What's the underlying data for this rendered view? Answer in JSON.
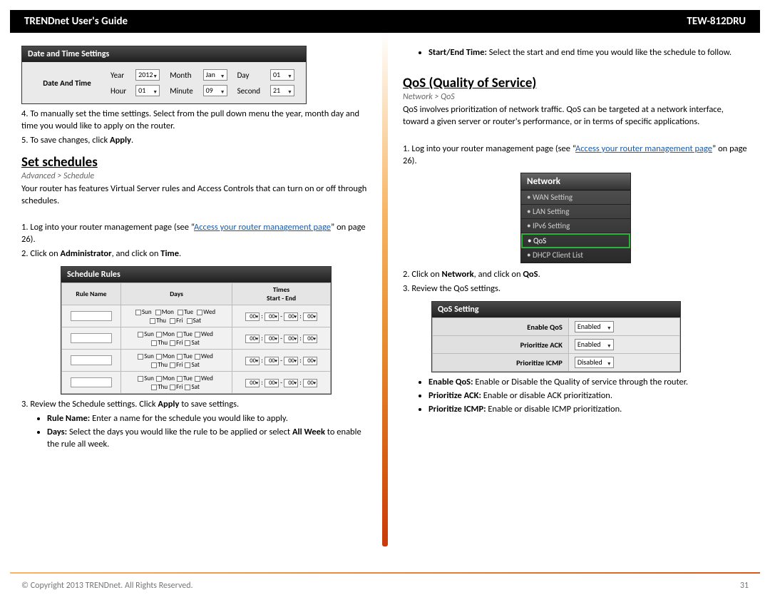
{
  "header": {
    "left": "TRENDnet User's Guide",
    "right": "TEW-812DRU"
  },
  "left": {
    "dt": {
      "title": "Date and Time Settings",
      "rowLabel": "Date And Time",
      "year_lbl": "Year",
      "year": "2012",
      "month_lbl": "Month",
      "month": "Jan",
      "day_lbl": "Day",
      "day": "01",
      "hour_lbl": "Hour",
      "hour": "01",
      "minute_lbl": "Minute",
      "minute": "09",
      "second_lbl": "Second",
      "second": "21"
    },
    "step4": "4. To manually set the time settings. Select from the pull down menu the year, month day and time you would like to apply on the router.",
    "step5a": "5. To save changes, click ",
    "step5b": "Apply",
    "step5c": ".",
    "section": "Set schedules",
    "bc": "Advanced > Schedule",
    "intro": "Your router has features Virtual Server rules and Access Controls that can turn on or off through schedules.",
    "s1a": "1. Log into your router management page (see “",
    "s1link": "Access your router management page",
    "s1b": "” on page 26).",
    "s2a": "2. Click on ",
    "s2b": "Administrator",
    "s2c": ", and click on ",
    "s2d": "Time",
    "s2e": ".",
    "sched": {
      "title": "Schedule Rules",
      "cols": {
        "name": "Rule Name",
        "days": "Days",
        "times": "Times\nStart - End"
      },
      "days": [
        "Sun",
        "Mon",
        "Tue",
        "Wed",
        "Thu",
        "Fri",
        "Sat"
      ],
      "t00": "00"
    },
    "s3a": "3. Review the Schedule settings. Click ",
    "s3b": "Apply",
    "s3c": " to save settings.",
    "b_rule_a": "Rule Name: ",
    "b_rule_b": "Enter a name for the schedule you would like to apply.",
    "b_days_a": "Days: ",
    "b_days_b": "Select the days you would like the rule to be applied or select ",
    "b_days_c": "All Week",
    "b_days_d": " to enable the rule all week."
  },
  "right": {
    "b_se_a": "Start/End Time: ",
    "b_se_b": "Select the start and end time you would like the schedule to follow.",
    "section": "QoS (Quality of Service)",
    "bc": "Network > QoS",
    "intro": "QoS involves prioritization of network traffic. QoS can be targeted at a network interface, toward a given server or router's performance, or in terms of specific applications.",
    "s1a": "1. Log into your router management page (see “",
    "s1link": "Access your router management page",
    "s1b": "” on page 26).",
    "menu": {
      "title": "Network",
      "items": [
        "WAN Setting",
        "LAN Setting",
        "IPv6 Setting",
        "QoS",
        "DHCP Client List"
      ]
    },
    "s2a": "2. Click on ",
    "s2b": "Network",
    "s2c": ", and click on ",
    "s2d": "QoS",
    "s2e": ".",
    "s3": "3. Review the QoS settings.",
    "qos": {
      "title": "QoS Setting",
      "r1l": "Enable QoS",
      "r1v": "Enabled",
      "r2l": "Prioritize ACK",
      "r2v": "Enabled",
      "r3l": "Prioritize ICMP",
      "r3v": "Disabled"
    },
    "b1a": "Enable QoS: ",
    "b1b": "Enable or Disable the Quality of service through the router.",
    "b2a": "Prioritize ACK: ",
    "b2b": "Enable or disable ACK prioritization.",
    "b3a": "Prioritize ICMP: ",
    "b3b": "Enable or disable ICMP prioritization."
  },
  "footer": {
    "copy": "© Copyright 2013 TRENDnet. All Rights Reserved.",
    "page": "31"
  }
}
